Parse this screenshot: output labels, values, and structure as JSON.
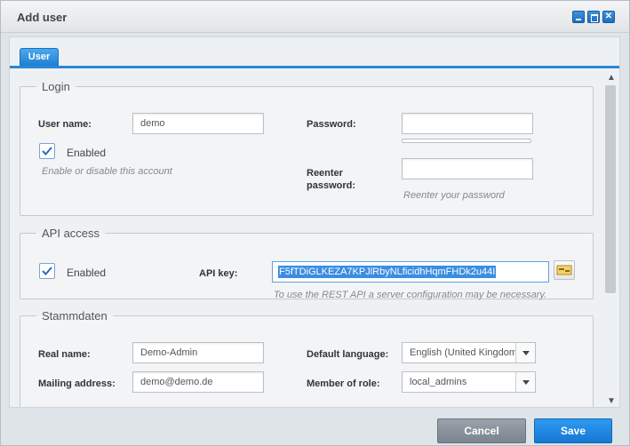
{
  "window": {
    "title": "Add user"
  },
  "tabs": [
    {
      "label": "User"
    }
  ],
  "login": {
    "legend": "Login",
    "user_name_label": "User name:",
    "user_name_value": "demo",
    "password_label": "Password:",
    "enabled_label": "Enabled",
    "enabled_hint": "Enable or disable this account",
    "reenter_label_line1": "Reenter",
    "reenter_label_line2": "password:",
    "reenter_hint": "Reenter your password"
  },
  "api": {
    "legend": "API access",
    "enabled_label": "Enabled",
    "api_key_label": "API key:",
    "api_key_value": "F5fTDiGLKEZA7KPJlRbyNLficidhHqmFHDk2u44I",
    "hint": "To use the REST API a server configuration may be necessary."
  },
  "stammdaten": {
    "legend": "Stammdaten",
    "real_name_label": "Real name:",
    "real_name_value": "Demo-Admin",
    "mailing_label": "Mailing address:",
    "mailing_value": "demo@demo.de",
    "default_language_label": "Default language:",
    "default_language_value": "English (United Kingdom",
    "member_of_role_label": "Member of role:",
    "member_of_role_value": "local_admins"
  },
  "buttons": {
    "cancel": "Cancel",
    "save": "Save"
  }
}
